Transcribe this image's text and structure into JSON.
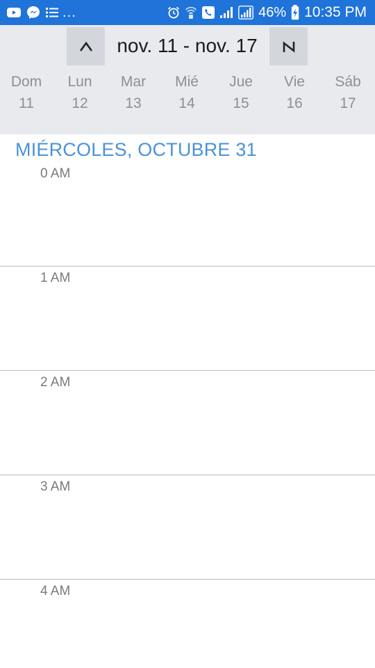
{
  "status_bar": {
    "left_overflow": "...",
    "battery_percent": "46%",
    "time": "10:35 PM",
    "icons_left": [
      "youtube-icon",
      "messenger-icon",
      "list-icon"
    ],
    "icons_right": [
      "alarm-icon",
      "wifi-call-icon",
      "phone-call-icon",
      "signal-icon",
      "signal-icon",
      "battery-charging-icon"
    ]
  },
  "week_header": {
    "range": "nov. 11 - nov. 17",
    "prev_icon": "chevron-up-icon",
    "next_icon": "chevron-down-icon",
    "days": [
      {
        "name": "Dom",
        "num": "11"
      },
      {
        "name": "Lun",
        "num": "12"
      },
      {
        "name": "Mar",
        "num": "13"
      },
      {
        "name": "Mié",
        "num": "14"
      },
      {
        "name": "Jue",
        "num": "15"
      },
      {
        "name": "Vie",
        "num": "16"
      },
      {
        "name": "Sáb",
        "num": "17"
      }
    ]
  },
  "agenda": {
    "date_heading": "MIÉRCOLES, OCTUBRE 31",
    "hours": [
      "0 AM",
      "1 AM",
      "2 AM",
      "3 AM",
      "4 AM"
    ]
  },
  "colors": {
    "status_bar": "#1f73d9",
    "header_bg": "#e8eaee",
    "accent": "#4a92d9"
  }
}
